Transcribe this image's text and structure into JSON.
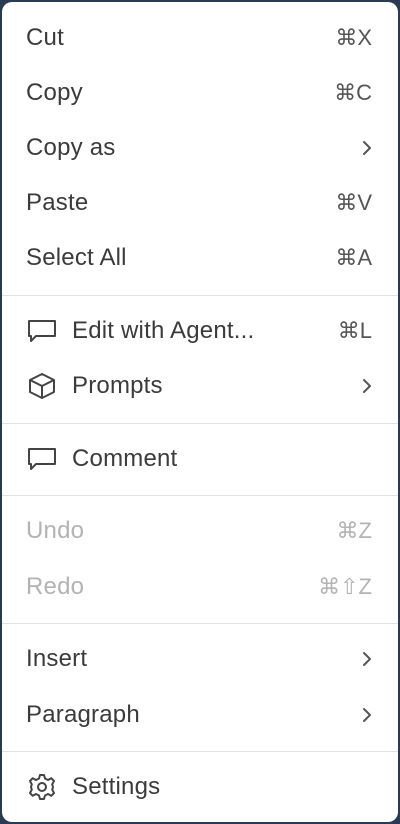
{
  "menu": {
    "items": [
      {
        "label": "Cut",
        "shortcut": "⌘X"
      },
      {
        "label": "Copy",
        "shortcut": "⌘C"
      },
      {
        "label": "Copy as",
        "submenu": true
      },
      {
        "label": "Paste",
        "shortcut": "⌘V"
      },
      {
        "label": "Select All",
        "shortcut": "⌘A"
      },
      {
        "label": "Edit with Agent...",
        "shortcut": "⌘L",
        "icon": "chat-bubble-icon"
      },
      {
        "label": "Prompts",
        "submenu": true,
        "icon": "cube-icon"
      },
      {
        "label": "Comment",
        "icon": "comment-icon"
      },
      {
        "label": "Undo",
        "shortcut": "⌘Z",
        "disabled": true
      },
      {
        "label": "Redo",
        "shortcut": "⌘⇧Z",
        "disabled": true
      },
      {
        "label": "Insert",
        "submenu": true
      },
      {
        "label": "Paragraph",
        "submenu": true
      },
      {
        "label": "Settings",
        "icon": "gear-icon"
      }
    ]
  },
  "colors": {
    "background": "#ffffff",
    "text": "#3b3b3b",
    "disabled_text": "#b3b3b3",
    "separator": "#e2e2e2"
  }
}
